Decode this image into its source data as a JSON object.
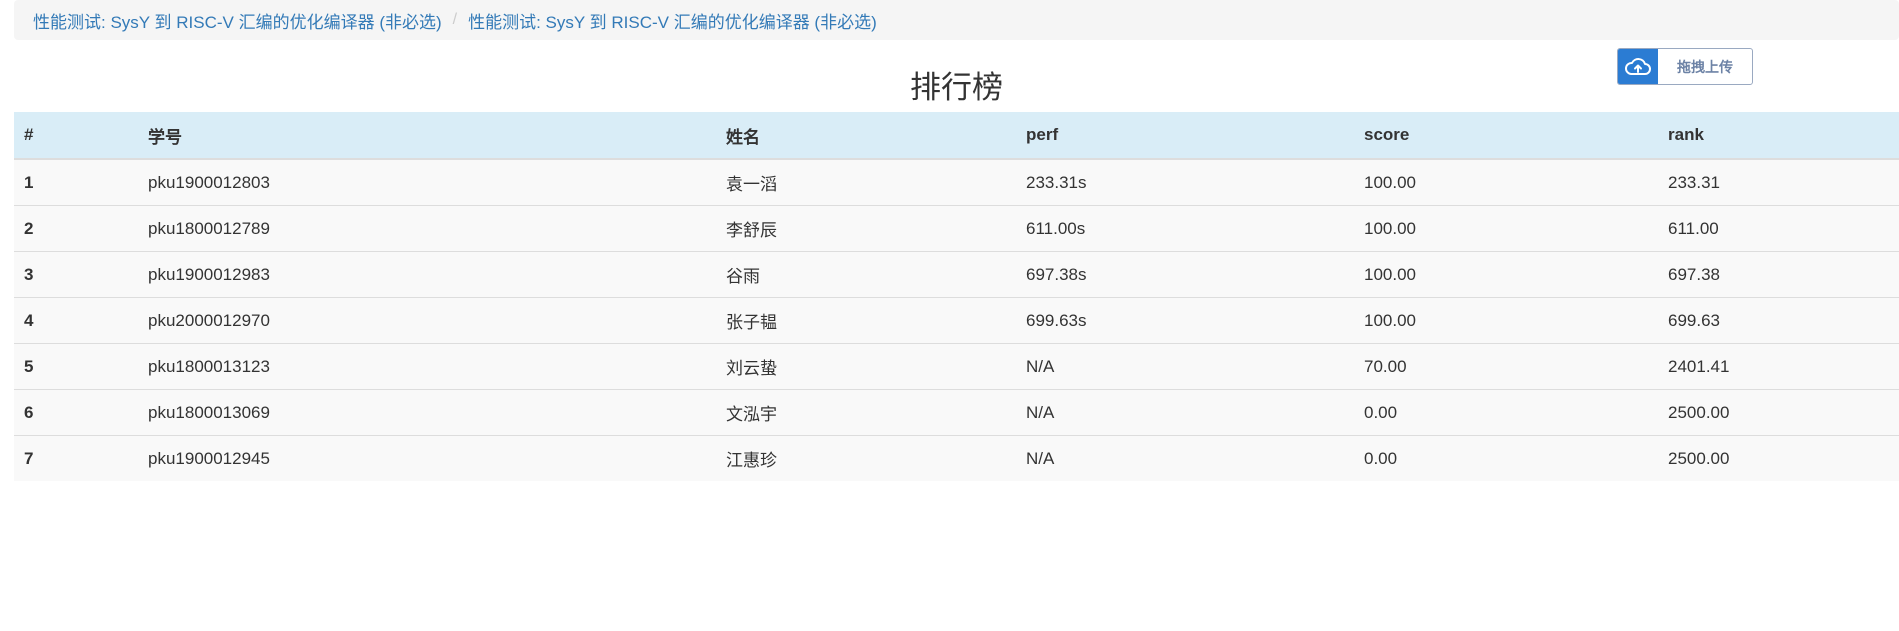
{
  "breadcrumb": {
    "items": [
      "性能测试: SysY 到 RISC-V 汇编的优化编译器 (非必选)",
      "性能测试: SysY 到 RISC-V 汇编的优化编译器 (非必选)"
    ],
    "separator": "/"
  },
  "page": {
    "title": "排行榜"
  },
  "upload": {
    "label": "拖拽上传",
    "icon": "cloud-upload-icon"
  },
  "table": {
    "headers": [
      "#",
      "学号",
      "姓名",
      "perf",
      "score",
      "rank"
    ],
    "rows": [
      [
        "1",
        "pku1900012803",
        "袁一滔",
        "233.31s",
        "100.00",
        "233.31"
      ],
      [
        "2",
        "pku1800012789",
        "李舒辰",
        "611.00s",
        "100.00",
        "611.00"
      ],
      [
        "3",
        "pku1900012983",
        "谷雨",
        "697.38s",
        "100.00",
        "697.38"
      ],
      [
        "4",
        "pku2000012970",
        "张子韫",
        "699.63s",
        "100.00",
        "699.63"
      ],
      [
        "5",
        "pku1800013123",
        "刘云蛰",
        "N/A",
        "70.00",
        "2401.41"
      ],
      [
        "6",
        "pku1800013069",
        "文泓宇",
        "N/A",
        "0.00",
        "2500.00"
      ],
      [
        "7",
        "pku1900012945",
        "江惠珍",
        "N/A",
        "0.00",
        "2500.00"
      ]
    ]
  },
  "colors": {
    "link": "#337ab7",
    "header_bg": "#d9edf7",
    "upload_icon_bg": "#2b7cd3"
  }
}
